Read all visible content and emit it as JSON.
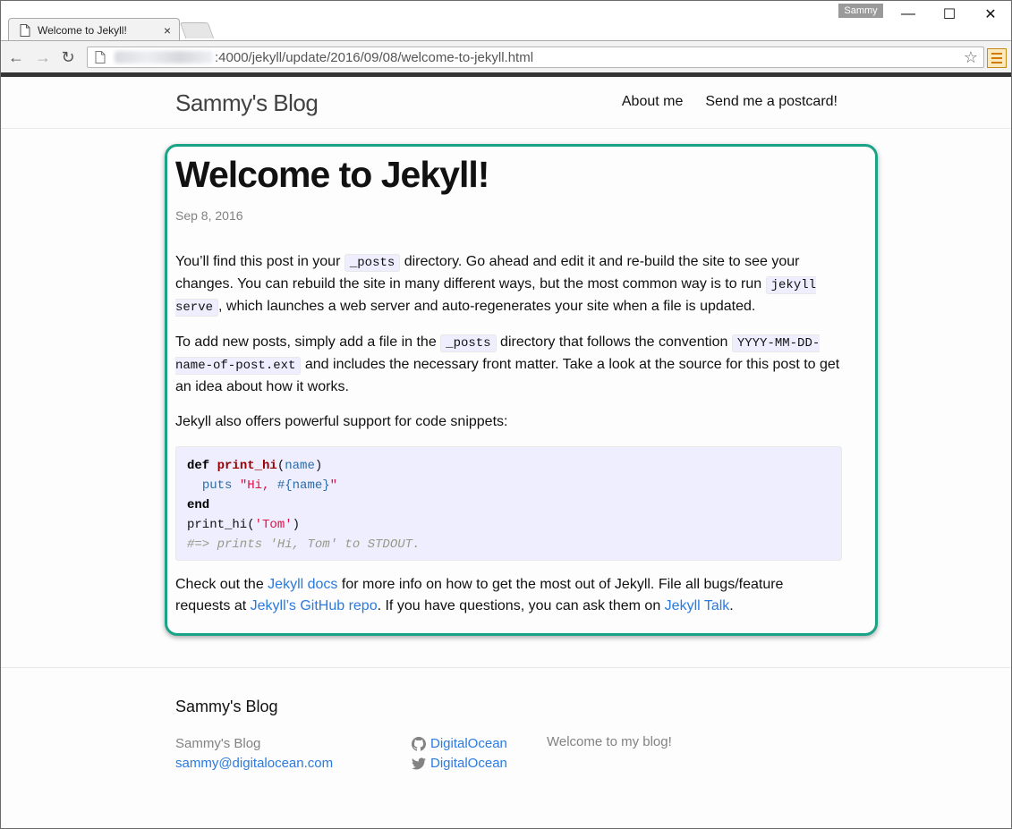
{
  "browser": {
    "tab_title": "Welcome to Jekyll!",
    "tab_close": "×",
    "profile_name": "Sammy",
    "url_visible": ":4000/jekyll/update/2016/09/08/welcome-to-jekyll.html",
    "win_minimize": "—",
    "win_maximize": "☐",
    "win_close": "✕",
    "back_icon": "←",
    "forward_icon": "→",
    "reload_icon": "↻",
    "star_icon": "☆"
  },
  "site": {
    "title": "Sammy's Blog",
    "nav": [
      "About me",
      "Send me a postcard!"
    ]
  },
  "post": {
    "title": "Welcome to Jekyll!",
    "date": "Sep 8, 2016",
    "p1": {
      "t1": "You’ll find this post in your ",
      "c1": "_posts",
      "t2": " directory. Go ahead and edit it and re-build the site to see your changes. You can rebuild the site in many different ways, but the most common way is to run ",
      "c2": "jekyll serve",
      "t3": ", which launches a web server and auto-regenerates your site when a file is updated."
    },
    "p2": {
      "t1": "To add new posts, simply add a file in the ",
      "c1": "_posts",
      "t2": " directory that follows the convention ",
      "c2": "YYYY-MM-DD-name-of-post.ext",
      "t3": " and includes the necessary front matter. Take a look at the source for this post to get an idea about how it works."
    },
    "p3": "Jekyll also offers powerful support for code snippets:",
    "code": {
      "l1_kw": "def",
      "l1_fn": "print_hi",
      "l1_open": "(",
      "l1_arg": "name",
      "l1_close": ")",
      "l2_indent": "  ",
      "l2_fn": "puts",
      "l2_sp": " ",
      "l2_str_a": "\"Hi, ",
      "l2_interp": "#{name}",
      "l2_str_b": "\"",
      "l3_kw": "end",
      "l4_call": "print_hi(",
      "l4_str": "'Tom'",
      "l4_close": ")",
      "l5_comment": "#=> prints 'Hi, Tom' to STDOUT."
    },
    "p4": {
      "t1": "Check out the ",
      "link1": "Jekyll docs",
      "t2": " for more info on how to get the most out of Jekyll. File all bugs/feature requests at ",
      "link2": "Jekyll’s GitHub repo",
      "t3": ". If you have questions, you can ask them on ",
      "link3": "Jekyll Talk",
      "t4": "."
    }
  },
  "footer": {
    "heading": "Sammy's Blog",
    "name": "Sammy's Blog",
    "email": "sammy@digitalocean.com",
    "github": "DigitalOcean",
    "twitter": "DigitalOcean",
    "description": "Welcome to my blog!"
  },
  "colors": {
    "accent_border": "#1aa386",
    "link": "#2a7ae2",
    "code_bg": "#eeeeff"
  }
}
